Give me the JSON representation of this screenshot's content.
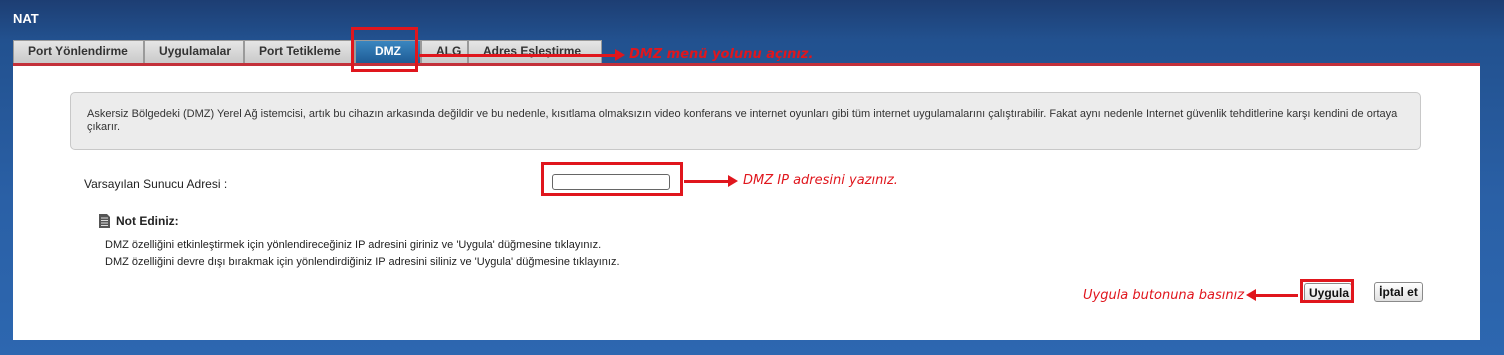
{
  "app": {
    "title": "NAT"
  },
  "tabs": [
    {
      "label": "Port Yönlendirme"
    },
    {
      "label": "Uygulamalar"
    },
    {
      "label": "Port Tetikleme"
    },
    {
      "label": "DMZ",
      "active": true
    },
    {
      "label": "ALG"
    },
    {
      "label": "Adres Eşleştirme"
    }
  ],
  "info": {
    "text": "Askersiz Bölgedeki (DMZ) Yerel Ağ istemcisi, artık bu cihazın arkasında değildir ve bu nedenle, kısıtlama olmaksızın video konferans ve internet oyunları gibi tüm internet uygulamalarını çalıştırabilir. Fakat aynı nedenle Internet güvenlik tehditlerine karşı kendini de ortaya çıkarır."
  },
  "form": {
    "default_server_label": "Varsayılan Sunucu Adresi :",
    "default_server_value": ""
  },
  "note": {
    "title": "Not Ediniz:",
    "icon": "document-icon",
    "lines": [
      "DMZ özelliğini etkinleştirmek için yönlendireceğiniz IP adresini giriniz ve 'Uygula' düğmesine tıklayınız.",
      "DMZ özelliğini devre dışı bırakmak için yönlendirdiğiniz IP adresini siliniz ve 'Uygula' düğmesine tıklayınız."
    ]
  },
  "buttons": {
    "apply": "Uygula",
    "cancel": "İptal et"
  },
  "annotations": {
    "dmz_menu": "DMZ menü yolunu açınız.",
    "ip_address": "DMZ IP adresini yazınız.",
    "apply_button": "Uygula butonuna basınız"
  },
  "colors": {
    "header_bg": "#22518f",
    "active_tab": "#2f78b5",
    "accent_line": "#c3303a",
    "annotation_red": "#e0161d"
  }
}
